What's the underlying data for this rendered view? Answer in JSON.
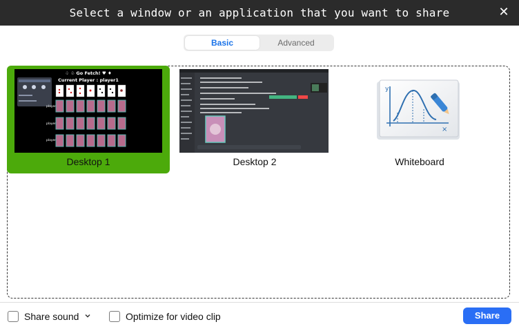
{
  "dialog": {
    "title": "Select a window or an application that you want to share",
    "close_glyph": "✕"
  },
  "tabs": [
    {
      "label": "Basic",
      "active": true
    },
    {
      "label": "Advanced",
      "active": false
    }
  ],
  "sources": [
    {
      "label": "Desktop 1",
      "selected": true
    },
    {
      "label": "Desktop 2",
      "selected": false
    },
    {
      "label": "Whiteboard",
      "selected": false
    }
  ],
  "desktop1_preview": {
    "header": "♤ ♧ Go Fetch! ♥ ♦",
    "current_player": "Current Player : player1",
    "row_labels": [
      "player2",
      "player3",
      "player4"
    ]
  },
  "footer": {
    "share_sound_label": "Share sound",
    "optimize_label": "Optimize for video clip",
    "share_button": "Share"
  },
  "colors": {
    "accent": "#2a6ef5",
    "selected_tile": "#4caa0b",
    "titlebar": "#2b2b2b"
  }
}
